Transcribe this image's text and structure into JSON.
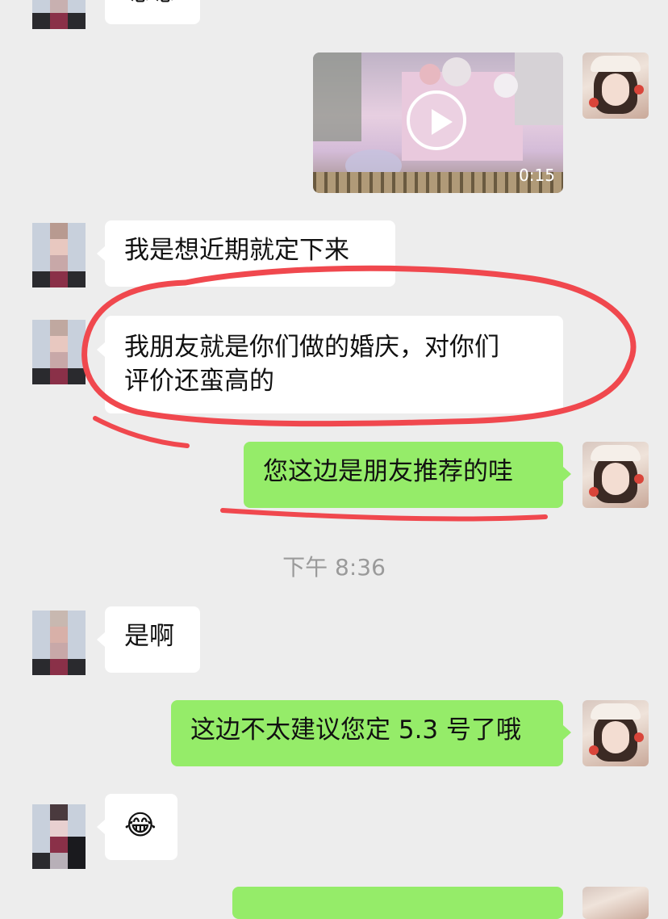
{
  "messages": {
    "partial_top": "嗯嗯",
    "video": {
      "duration": "0:15"
    },
    "m1": "我是想近期就定下来",
    "m2_line1": "我朋友就是你们做的婚庆，对你们",
    "m2_line2": "评价还蛮高的",
    "m3": "您这边是朋友推荐的哇",
    "timestamp": "下午 8:36",
    "m4": "是啊",
    "m5": "这边不太建议您定 5.3 号了哦",
    "m6_emoji": "😂"
  },
  "colors": {
    "background": "#ededed",
    "incoming_bubble": "#ffffff",
    "outgoing_bubble": "#95ec69",
    "annotation_red": "#f0484e"
  },
  "icons": {
    "play": "play-icon",
    "emoji": "tears-of-joy-emoji"
  }
}
